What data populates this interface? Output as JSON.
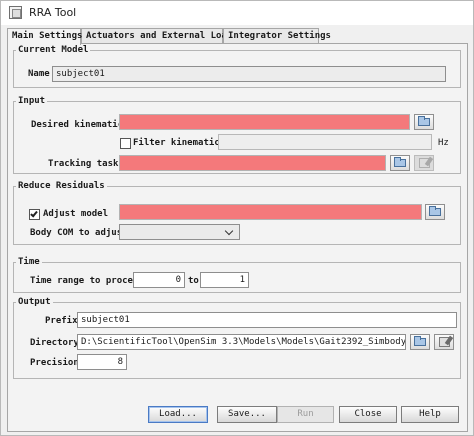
{
  "window": {
    "title": "RRA Tool",
    "icon": "app-window-icon"
  },
  "tabs": [
    {
      "label": "Main Settings",
      "active": true
    },
    {
      "label": "Actuators and External Loads",
      "active": false
    },
    {
      "label": "Integrator Settings",
      "active": false
    }
  ],
  "current_model": {
    "legend": "Current Model",
    "name_label": "Name",
    "name_value": "subject01"
  },
  "input": {
    "legend": "Input",
    "desired_kinematics_label": "Desired kinematics",
    "desired_kinematics_value": "",
    "filter_label": "Filter kinematics",
    "filter_checked": false,
    "filter_value": "",
    "filter_unit": "Hz",
    "tracking_tasks_label": "Tracking tasks",
    "tracking_tasks_value": ""
  },
  "reduce_residuals": {
    "legend": "Reduce Residuals",
    "adjust_model_label": "Adjust model",
    "adjust_model_checked": true,
    "adjust_model_value": "",
    "body_com_label": "Body COM to adjust",
    "body_com_value": ""
  },
  "time": {
    "legend": "Time",
    "range_label": "Time range to process",
    "start": "0",
    "to_label": "to",
    "end": "1"
  },
  "output": {
    "legend": "Output",
    "prefix_label": "Prefix",
    "prefix_value": "subject01",
    "directory_label": "Directory",
    "directory_value": "D:\\ScientificTool\\OpenSim 3.3\\Models\\Models\\Gait2392_Simbody",
    "precision_label": "Precision",
    "precision_value": "8"
  },
  "buttons": {
    "load": "Load...",
    "save": "Save...",
    "run": "Run",
    "close": "Close",
    "help": "Help"
  },
  "colors": {
    "error_field": "#f4797b",
    "focus_border": "#4a7ac4",
    "folder_icon": "#a9c6e6"
  }
}
